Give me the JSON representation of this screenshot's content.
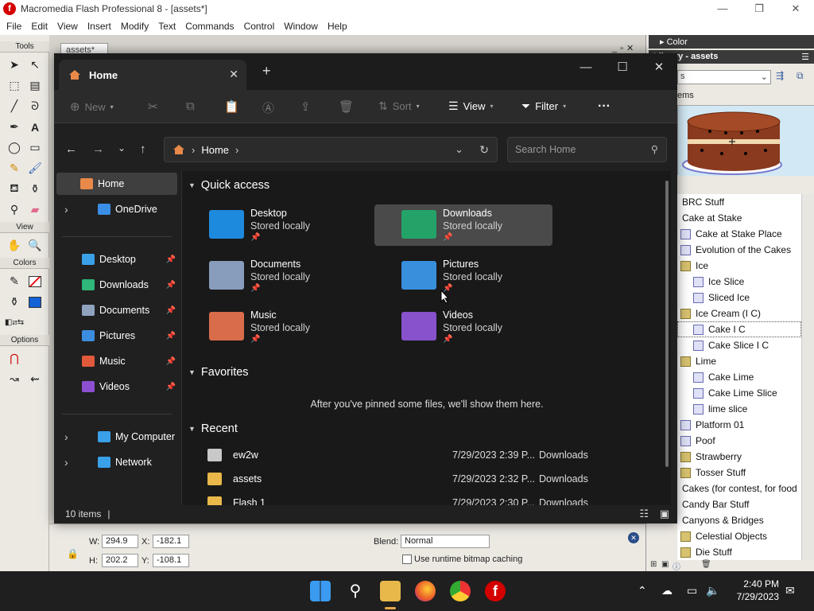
{
  "flash": {
    "title": "Macromedia Flash Professional 8 - [assets*]",
    "menu": [
      "File",
      "Edit",
      "View",
      "Insert",
      "Modify",
      "Text",
      "Commands",
      "Control",
      "Window",
      "Help"
    ],
    "tools_label": "Tools",
    "view_label": "View",
    "colors_label": "Colors",
    "options_label": "Options",
    "doc_tab": "assets*",
    "props": {
      "w_label": "W:",
      "w": "294.9",
      "h_label": "H:",
      "h": "202.2",
      "x_label": "X:",
      "x": "-182.1",
      "y_label": "Y:",
      "y": "-108.1",
      "blend_label": "Blend:",
      "blend": "Normal",
      "cache_label": "Use runtime bitmap caching"
    },
    "color_panel": "Color",
    "library_title": "Library - assets",
    "items_label": "ems",
    "library_items": [
      {
        "label": "BRC Stuff",
        "type": "text",
        "indent": 0
      },
      {
        "label": "Cake at Stake",
        "type": "text",
        "indent": 0
      },
      {
        "label": "Cake at Stake Place",
        "type": "symbol",
        "indent": 0
      },
      {
        "label": "Evolution of the Cakes",
        "type": "symbol",
        "indent": 0
      },
      {
        "label": "Ice",
        "type": "folder",
        "indent": 0
      },
      {
        "label": "Ice Slice",
        "type": "symbol",
        "indent": 1
      },
      {
        "label": "Sliced Ice",
        "type": "symbol",
        "indent": 1
      },
      {
        "label": "Ice Cream (I C)",
        "type": "folder",
        "indent": 0
      },
      {
        "label": "Cake I C",
        "type": "symbol",
        "indent": 1,
        "selected": true
      },
      {
        "label": "Cake Slice I C",
        "type": "symbol",
        "indent": 1
      },
      {
        "label": "Lime",
        "type": "folder",
        "indent": 0
      },
      {
        "label": "Cake Lime",
        "type": "symbol",
        "indent": 1
      },
      {
        "label": "Cake Lime Slice",
        "type": "symbol",
        "indent": 1
      },
      {
        "label": "lime slice",
        "type": "symbol",
        "indent": 1
      },
      {
        "label": "Platform 01",
        "type": "symbol",
        "indent": 0
      },
      {
        "label": "Poof",
        "type": "symbol",
        "indent": 0
      },
      {
        "label": "Strawberry",
        "type": "folder",
        "indent": 0
      },
      {
        "label": "Tosser Stuff",
        "type": "folder",
        "indent": 0
      },
      {
        "label": "Cakes (for contest, for food",
        "type": "text",
        "indent": 0
      },
      {
        "label": "Candy Bar Stuff",
        "type": "text",
        "indent": 0
      },
      {
        "label": "Canyons & Bridges",
        "type": "text",
        "indent": 0
      },
      {
        "label": "Celestial Objects",
        "type": "folder",
        "indent": 0
      },
      {
        "label": "Die Stuff",
        "type": "folder",
        "indent": 0
      }
    ]
  },
  "explorer": {
    "tab_title": "Home",
    "new_tab": "+",
    "commands": {
      "new": "New",
      "sort": "Sort",
      "view": "View",
      "filter": "Filter",
      "more": "···"
    },
    "address": "Home",
    "search_placeholder": "Search Home",
    "nav": [
      {
        "label": "Home",
        "selected": true,
        "color": "#e8894a"
      },
      {
        "label": "OneDrive",
        "expander": true,
        "color": "#3a8ee6"
      },
      {
        "label": "Desktop",
        "pin": true,
        "color": "#3aa0e8"
      },
      {
        "label": "Downloads",
        "pin": true,
        "color": "#2fb679"
      },
      {
        "label": "Documents",
        "pin": true,
        "color": "#8fa3bf"
      },
      {
        "label": "Pictures",
        "pin": true,
        "color": "#3b8de0"
      },
      {
        "label": "Music",
        "pin": true,
        "color": "#e05a3b"
      },
      {
        "label": "Videos",
        "pin": true,
        "color": "#8c4fd1"
      },
      {
        "label": "My Computer",
        "expander": true,
        "color": "#3aa0e8"
      },
      {
        "label": "Network",
        "expander": true,
        "color": "#3aa0e8"
      }
    ],
    "sections": {
      "quick": "Quick access",
      "favorites": "Favorites",
      "recent": "Recent"
    },
    "quick_access": [
      {
        "name": "Desktop",
        "sub": "Stored locally",
        "color": "#1e90e8"
      },
      {
        "name": "Downloads",
        "sub": "Stored locally",
        "color": "#22a86a",
        "selected": true
      },
      {
        "name": "Documents",
        "sub": "Stored locally",
        "color": "#8ea4c4"
      },
      {
        "name": "Pictures",
        "sub": "Stored locally",
        "color": "#3a95e6"
      },
      {
        "name": "Music",
        "sub": "Stored locally",
        "color": "#e3704d"
      },
      {
        "name": "Videos",
        "sub": "Stored locally",
        "color": "#8e55d6"
      }
    ],
    "favorites_empty": "After you've pinned some files, we'll show them here.",
    "recent": [
      {
        "name": "ew2w",
        "date": "7/29/2023 2:39 P...",
        "location": "Downloads",
        "color": "#c8c8c8"
      },
      {
        "name": "assets",
        "date": "7/29/2023 2:32 P...",
        "location": "Downloads",
        "color": "#e8b84a"
      },
      {
        "name": "Flash 1",
        "date": "7/29/2023 2:30 P...",
        "location": "Downloads",
        "color": "#e8b84a"
      }
    ],
    "status": "10 items"
  },
  "taskbar": {
    "time": "2:40 PM",
    "date": "7/29/2023"
  }
}
